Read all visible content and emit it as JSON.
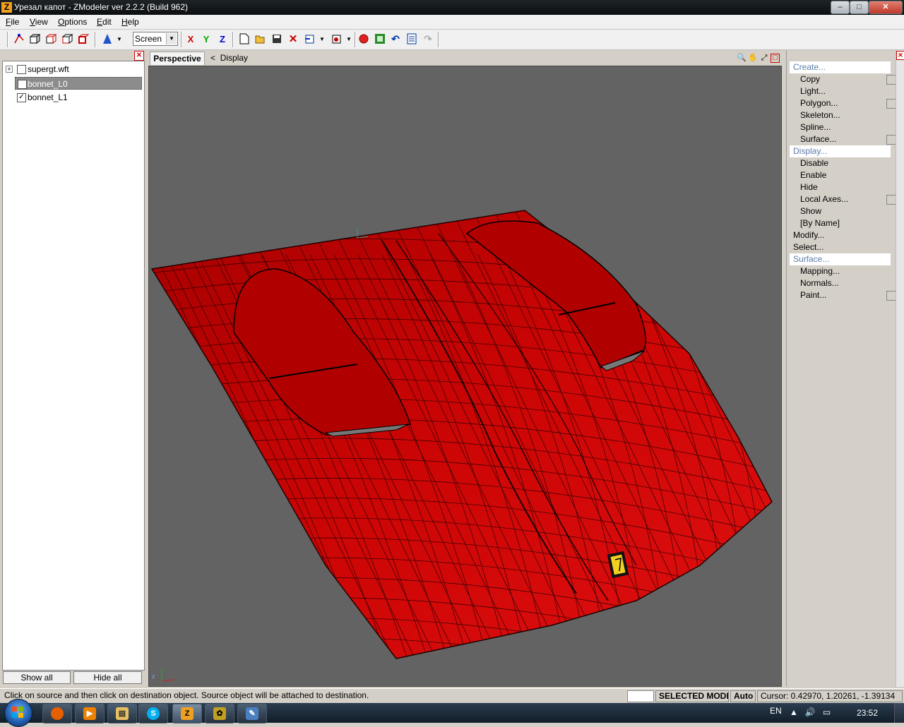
{
  "window": {
    "title": "Урезал капот - ZModeler ver 2.2.2 (Build 962)",
    "app_icon": "Z",
    "controls": {
      "minimize": "–",
      "maximize": "□",
      "close": "✕"
    }
  },
  "menubar": {
    "items": [
      {
        "label": "File",
        "key": "F"
      },
      {
        "label": "View",
        "key": "V"
      },
      {
        "label": "Options",
        "key": "O"
      },
      {
        "label": "Edit",
        "key": "E"
      },
      {
        "label": "Help",
        "key": "H"
      }
    ]
  },
  "toolbar": {
    "screen_select": "Screen",
    "axis_x": "X",
    "axis_y": "Y",
    "axis_z": "Z",
    "icons": [
      "vertex-mode-icon",
      "polygon-mode-icon",
      "object-mode-icon",
      "box-mode-icon",
      "frame-mode-icon",
      "light-icon",
      "new-file-icon",
      "open-file-icon",
      "save-icon",
      "delete-icon",
      "import-icon",
      "export-icon",
      "render-icon",
      "texture-icon",
      "undo-icon",
      "notes-icon",
      "redo-icon"
    ]
  },
  "left_panel": {
    "tree": [
      {
        "label": "supergt.wft",
        "checked": false,
        "expander": "+"
      },
      {
        "label": "bonnet_L0",
        "checked": false,
        "selected": true
      },
      {
        "label": "bonnet_L1",
        "checked": true
      }
    ],
    "show_all": "Show all",
    "hide_all": "Hide all"
  },
  "viewport": {
    "tab": "Perspective",
    "breadcrumb_arrow": "<",
    "breadcrumb": "Display",
    "axis_label_z": "z",
    "mesh_color": "#cc0000",
    "background": "#636363"
  },
  "right_panel": {
    "items": [
      {
        "label": "Create...",
        "kind": "sect"
      },
      {
        "label": "Copy",
        "kind": "sub",
        "box": true
      },
      {
        "label": "Light...",
        "kind": "sub"
      },
      {
        "label": "Polygon...",
        "kind": "sub",
        "box": true
      },
      {
        "label": "Skeleton...",
        "kind": "sub"
      },
      {
        "label": "Spline...",
        "kind": "sub"
      },
      {
        "label": "Surface...",
        "kind": "sub",
        "box": true
      },
      {
        "label": "Display...",
        "kind": "sect"
      },
      {
        "label": "Disable",
        "kind": "sub"
      },
      {
        "label": "Enable",
        "kind": "sub"
      },
      {
        "label": "Hide",
        "kind": "sub"
      },
      {
        "label": "Local Axes...",
        "kind": "sub",
        "box": true
      },
      {
        "label": "Show",
        "kind": "sub"
      },
      {
        "label": "[By Name]",
        "kind": "sub"
      },
      {
        "label": "Modify...",
        "kind": "top"
      },
      {
        "label": "Select...",
        "kind": "top"
      },
      {
        "label": "Surface...",
        "kind": "sect"
      },
      {
        "label": "Mapping...",
        "kind": "sub"
      },
      {
        "label": "Normals...",
        "kind": "sub"
      },
      {
        "label": "Paint...",
        "kind": "sub",
        "box": true
      }
    ]
  },
  "status": {
    "hint": "Click on source and then click on destination object. Source object will be attached to destination.",
    "mode": "SELECTED MODE",
    "auto": "Auto",
    "cursor": "Cursor: 0.42970, 1.20261, -1.39134"
  },
  "taskbar": {
    "lang": "EN",
    "time": "23:52",
    "apps": [
      "firefox-icon",
      "media-player-icon",
      "explorer-icon",
      "skype-icon",
      "zmodeler-icon",
      "tool-icon",
      "paint-icon"
    ]
  }
}
